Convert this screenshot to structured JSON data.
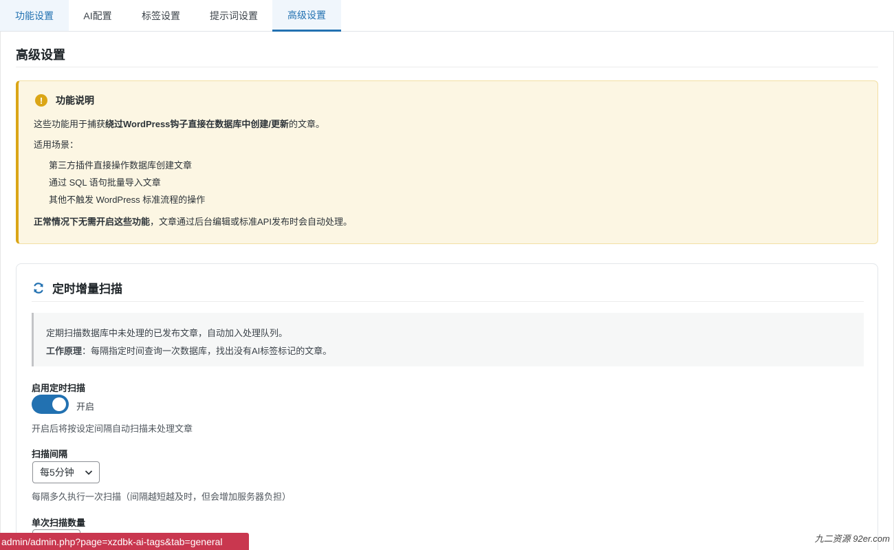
{
  "tabs": [
    {
      "label": "功能设置"
    },
    {
      "label": "AI配置"
    },
    {
      "label": "标签设置"
    },
    {
      "label": "提示词设置"
    },
    {
      "label": "高级设置"
    }
  ],
  "page_title": "高级设置",
  "notice": {
    "title": "功能说明",
    "line1_pre": "这些功能用于捕获",
    "line1_bold": "绕过WordPress钩子直接在数据库中创建/更新",
    "line1_post": "的文章。",
    "scenarios_label": "适用场景：",
    "scenarios": [
      "第三方插件直接操作数据库创建文章",
      "通过 SQL 语句批量导入文章",
      "其他不触发 WordPress 标准流程的操作"
    ],
    "footer_bold": "正常情况下无需开启这些功能",
    "footer_rest": "，文章通过后台编辑或标准API发布时会自动处理。"
  },
  "scan_card": {
    "title": "定时增量扫描",
    "desc1": "定期扫描数据库中未处理的已发布文章，自动加入处理队列。",
    "desc2_bold": "工作原理",
    "desc2_rest": "：每隔指定时间查询一次数据库，找出没有AI标签标记的文章。",
    "enable_label": "启用定时扫描",
    "toggle_state": "开启",
    "enable_help": "开启后将按设定间隔自动扫描未处理文章",
    "interval_label": "扫描间隔",
    "interval_value": "每5分钟",
    "interval_help": "每隔多久执行一次扫描（间隔越短越及时，但会增加服务器负担）",
    "batch_label": "单次扫描数量"
  },
  "status_url": "admin/admin.php?page=xzdbk-ai-tags&tab=general",
  "watermark": "九二资源 92er.com",
  "colors": {
    "accent": "#2271b1",
    "warning": "#dba617",
    "notice_bg": "#fcf6e3",
    "url_bar": "#c9374f"
  }
}
